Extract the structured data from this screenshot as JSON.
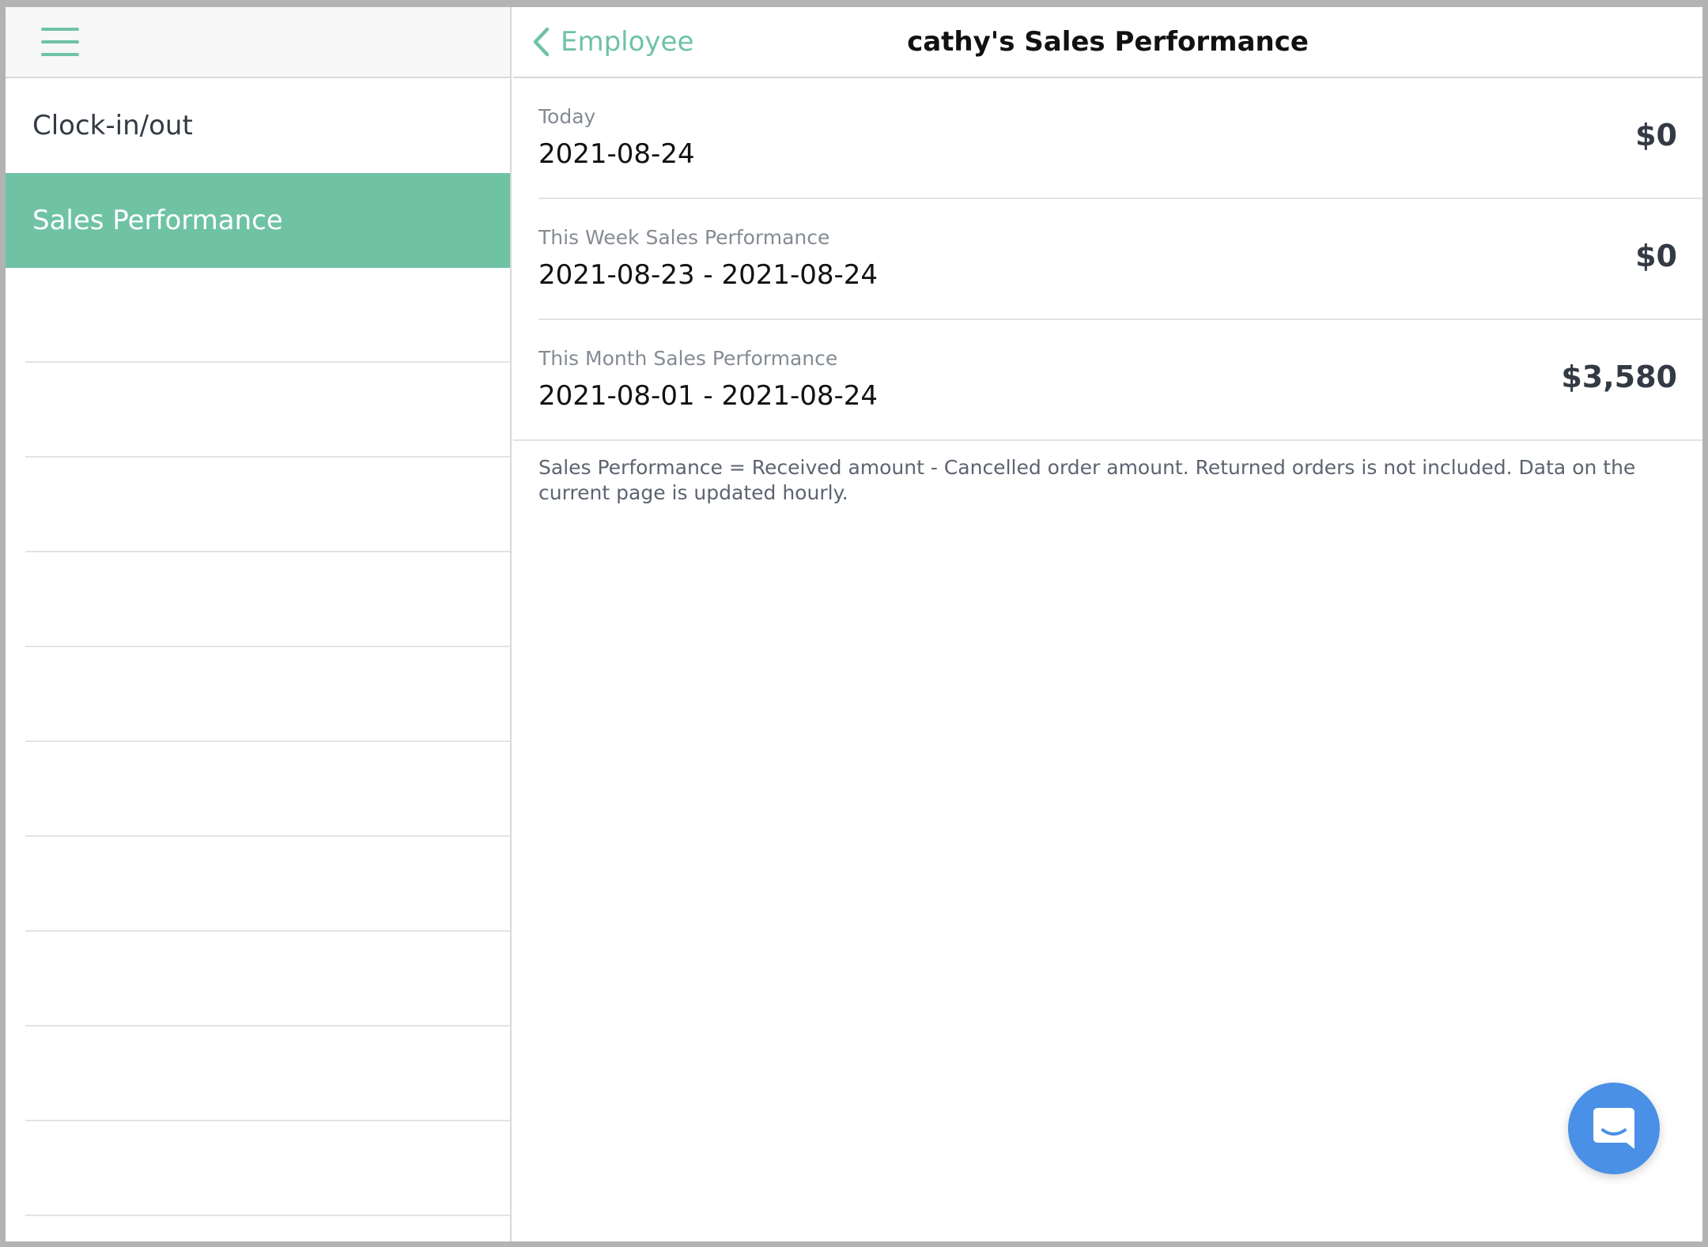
{
  "sidebar": {
    "menu_icon": "hamburger-icon",
    "items": [
      {
        "label": "Clock-in/out",
        "active": false
      },
      {
        "label": "Sales Performance",
        "active": true
      }
    ]
  },
  "header": {
    "back_label": "Employee",
    "back_icon": "chevron-left-icon",
    "title": "cathy's Sales Performance"
  },
  "performance": [
    {
      "label": "Today",
      "range": "2021-08-24",
      "amount": "$0"
    },
    {
      "label": "This Week Sales Performance",
      "range": "2021-08-23 - 2021-08-24",
      "amount": "$0"
    },
    {
      "label": "This Month Sales Performance",
      "range": "2021-08-01 - 2021-08-24",
      "amount": "$3,580"
    }
  ],
  "note": "Sales Performance = Received amount - Cancelled order amount. Returned orders is not included. Data on the current page is updated hourly.",
  "chat_button": {
    "icon": "chat-bubble-icon"
  },
  "colors": {
    "accent": "#6fc3a4",
    "chat": "#4a90e6"
  }
}
